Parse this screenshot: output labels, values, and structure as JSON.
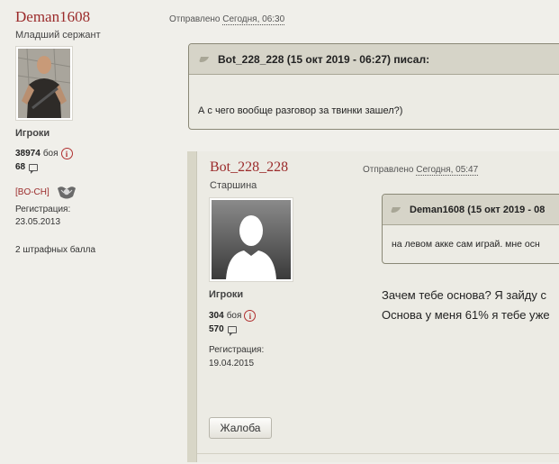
{
  "post1": {
    "author": {
      "name": "Deman1608",
      "rank": "Младший сержант",
      "group": "Игроки",
      "battles": "38974",
      "battles_label": "боя",
      "posts": "68",
      "clan": "[BO-CH]",
      "reg_label": "Регистрация:",
      "reg_date": "23.05.2013",
      "penalty": "2 штрафных балла"
    },
    "posted_prefix": "Отправлено",
    "posted_time": "Сегодня, 06:30",
    "quote": {
      "header": "Bot_228_228 (15 окт 2019 - 06:27) писал:",
      "text": "А с чего вообще разговор за твинки зашел?)"
    }
  },
  "post2": {
    "author": {
      "name": "Bot_228_228",
      "rank": "Старшина",
      "group": "Игроки",
      "battles": "304",
      "battles_label": "боя",
      "posts": "570",
      "reg_label": "Регистрация:",
      "reg_date": "19.04.2015"
    },
    "posted_prefix": "Отправлено",
    "posted_time": "Сегодня, 05:47",
    "quote": {
      "header": "Deman1608 (15 окт 2019 - 08",
      "text": "на левом акке сам играй. мне осн"
    },
    "text_line1": "Зачем тебе основа? Я зайду с",
    "text_line2": "Основа у меня 61% я тебе уже",
    "report_button": "Жалоба"
  }
}
